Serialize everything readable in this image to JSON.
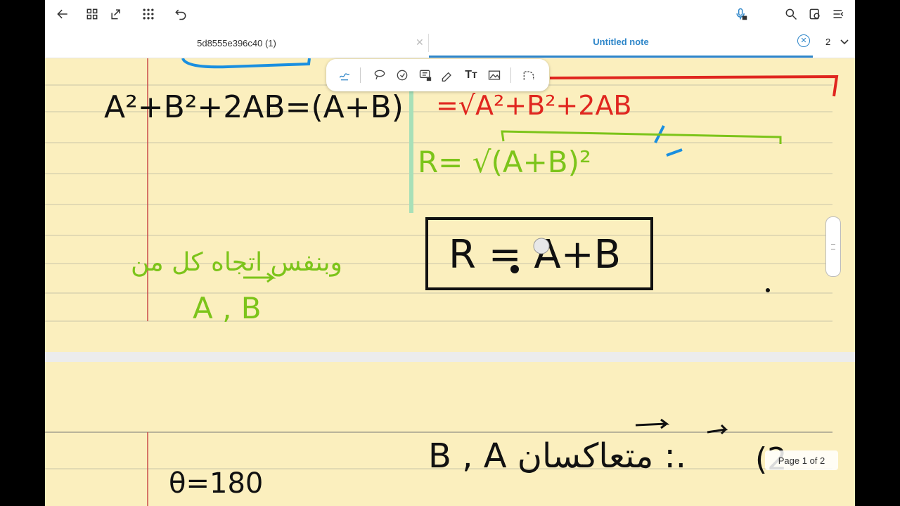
{
  "toolbar": {
    "back_icon": "back-arrow-icon",
    "grid_icon": "grid-view-icon",
    "share_icon": "share-icon",
    "apps_icon": "apps-icon",
    "undo_icon": "undo-icon",
    "mic_icon": "mic-locked-icon",
    "search_icon": "search-icon",
    "read_mode_icon": "read-mode-icon",
    "menu_icon": "menu-icon"
  },
  "tabs": [
    {
      "label": "5d8555e396c40 (1)",
      "active": false
    },
    {
      "label": "Untitled note",
      "active": true
    }
  ],
  "page_count": "2",
  "pen_toolbar": {
    "tools": [
      "pen-icon",
      "lasso-icon",
      "highlighter-icon",
      "text-box-locked-icon",
      "eraser-icon",
      "text-icon",
      "image-icon",
      "shape-icon"
    ],
    "text_tool_label": "Tт"
  },
  "page_indicator": "Page 1 of 2",
  "colors": {
    "accent": "#2e86c9",
    "paper": "#fbefbe",
    "ink_black": "#111111",
    "ink_red": "#e0261f",
    "ink_green": "#7cc41a",
    "ink_blue": "#1a8fe0",
    "margin_line": "#c94a4a",
    "rule_line": "#bdbdbd"
  },
  "handwriting": {
    "line1_black": "A²+B²+2AB=(A+B)",
    "line1_red": "=√A²+B²+2AB",
    "line2_green": "R= √(A+B)²",
    "arabic_green_line1": "وبنفس اتجاه كل من",
    "arabic_green_line2": "A , B",
    "boxed_result": "R = A+B",
    "arabic_black_line": "B , A متعاكسان :.",
    "page2_angle": "θ=180",
    "page2_item_number": "(2"
  }
}
